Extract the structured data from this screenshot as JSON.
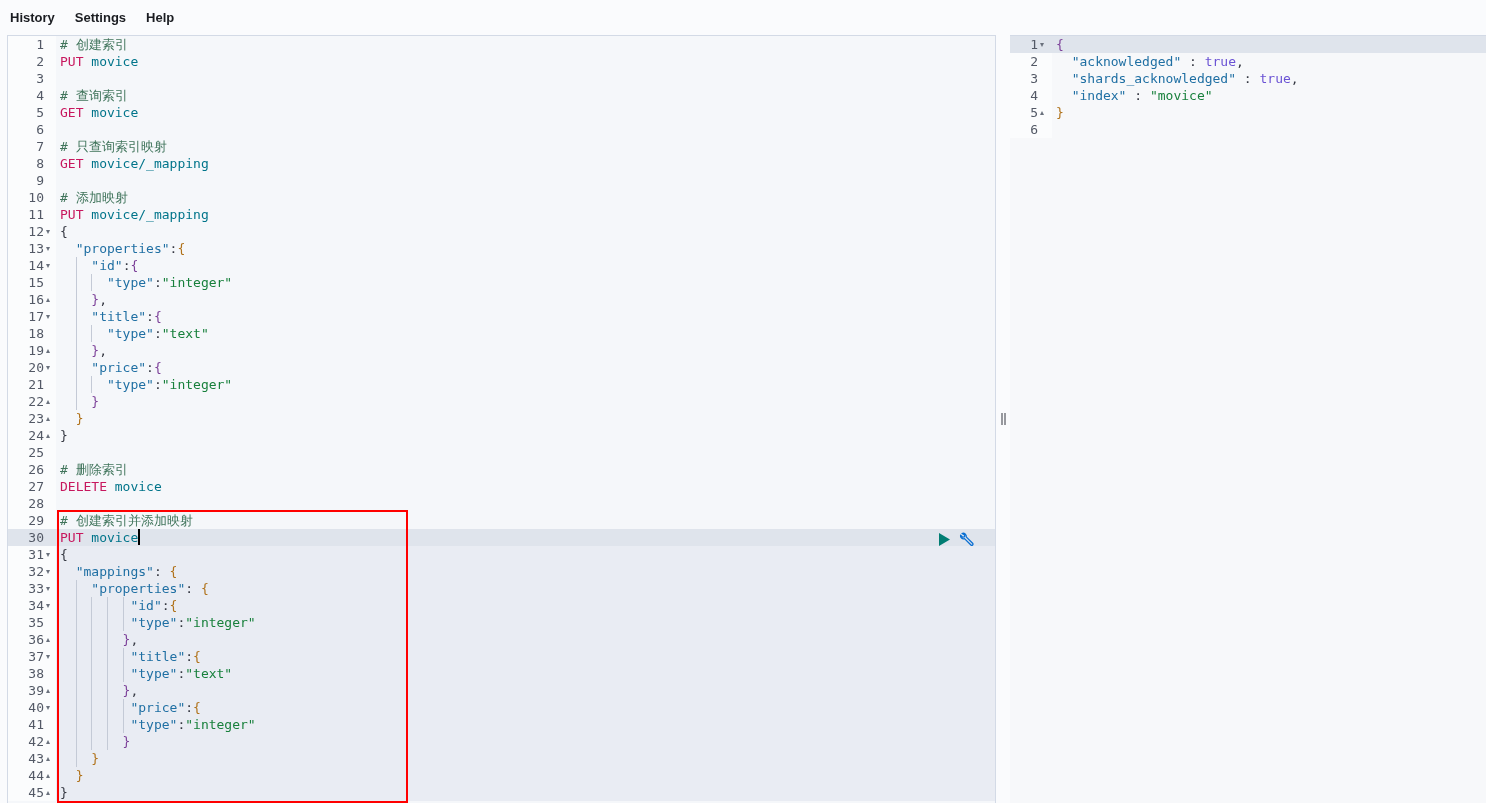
{
  "menu": [
    {
      "label": "History"
    },
    {
      "label": "Settings"
    },
    {
      "label": "Help"
    }
  ],
  "request_editor": {
    "lines": [
      {
        "no": "1",
        "tokens": [
          {
            "text": "# 创建索引",
            "kind": "comment"
          }
        ]
      },
      {
        "no": "2",
        "tokens": [
          {
            "text": "PUT",
            "kind": "method"
          },
          {
            "text": " movice",
            "kind": "path"
          }
        ]
      },
      {
        "no": "3"
      },
      {
        "no": "4",
        "tokens": [
          {
            "text": "# 查询索引",
            "kind": "comment"
          }
        ]
      },
      {
        "no": "5",
        "tokens": [
          {
            "text": "GET",
            "kind": "method"
          },
          {
            "text": " movice",
            "kind": "path"
          }
        ]
      },
      {
        "no": "6"
      },
      {
        "no": "7",
        "tokens": [
          {
            "text": "# 只查询索引映射",
            "kind": "comment"
          }
        ]
      },
      {
        "no": "8",
        "tokens": [
          {
            "text": "GET",
            "kind": "method"
          },
          {
            "text": " movice/_mapping",
            "kind": "path"
          }
        ]
      },
      {
        "no": "9"
      },
      {
        "no": "10",
        "tokens": [
          {
            "text": "# 添加映射",
            "kind": "comment"
          }
        ]
      },
      {
        "no": "11",
        "tokens": [
          {
            "text": "PUT",
            "kind": "method"
          },
          {
            "text": " movice/_mapping",
            "kind": "path"
          }
        ]
      },
      {
        "no": "12",
        "fold": "▾",
        "tokens": [
          {
            "text": "{",
            "kind": "brace1"
          }
        ]
      },
      {
        "no": "13",
        "fold": "▾",
        "tokens": [
          {
            "text": "  \"properties\"",
            "kind": "key"
          },
          {
            "text": ":",
            "kind": "punct"
          },
          {
            "text": "{",
            "kind": "brace2"
          }
        ]
      },
      {
        "no": "14",
        "fold": "▾",
        "tokens": [
          {
            "text": "    \"id\"",
            "kind": "key"
          },
          {
            "text": ":",
            "kind": "punct"
          },
          {
            "text": "{",
            "kind": "brace3"
          }
        ]
      },
      {
        "no": "15",
        "tokens": [
          {
            "text": "      \"type\"",
            "kind": "key"
          },
          {
            "text": ":",
            "kind": "punct"
          },
          {
            "text": "\"integer\"",
            "kind": "string"
          }
        ]
      },
      {
        "no": "16",
        "fold": "▴",
        "tokens": [
          {
            "text": "    }",
            "kind": "brace3"
          },
          {
            "text": ",",
            "kind": "punct"
          }
        ]
      },
      {
        "no": "17",
        "fold": "▾",
        "tokens": [
          {
            "text": "    \"title\"",
            "kind": "key"
          },
          {
            "text": ":",
            "kind": "punct"
          },
          {
            "text": "{",
            "kind": "brace3"
          }
        ]
      },
      {
        "no": "18",
        "tokens": [
          {
            "text": "      \"type\"",
            "kind": "key"
          },
          {
            "text": ":",
            "kind": "punct"
          },
          {
            "text": "\"text\"",
            "kind": "string"
          }
        ]
      },
      {
        "no": "19",
        "fold": "▴",
        "tokens": [
          {
            "text": "    }",
            "kind": "brace3"
          },
          {
            "text": ",",
            "kind": "punct"
          }
        ]
      },
      {
        "no": "20",
        "fold": "▾",
        "tokens": [
          {
            "text": "    \"price\"",
            "kind": "key"
          },
          {
            "text": ":",
            "kind": "punct"
          },
          {
            "text": "{",
            "kind": "brace3"
          }
        ]
      },
      {
        "no": "21",
        "tokens": [
          {
            "text": "      \"type\"",
            "kind": "key"
          },
          {
            "text": ":",
            "kind": "punct"
          },
          {
            "text": "\"integer\"",
            "kind": "string"
          }
        ]
      },
      {
        "no": "22",
        "fold": "▴",
        "tokens": [
          {
            "text": "    }",
            "kind": "brace3"
          }
        ]
      },
      {
        "no": "23",
        "fold": "▴",
        "tokens": [
          {
            "text": "  }",
            "kind": "brace2"
          }
        ]
      },
      {
        "no": "24",
        "fold": "▴",
        "tokens": [
          {
            "text": "}",
            "kind": "brace1"
          }
        ]
      },
      {
        "no": "25"
      },
      {
        "no": "26",
        "tokens": [
          {
            "text": "# 删除索引",
            "kind": "comment"
          }
        ]
      },
      {
        "no": "27",
        "tokens": [
          {
            "text": "DELETE",
            "kind": "method"
          },
          {
            "text": " movice",
            "kind": "path"
          }
        ]
      },
      {
        "no": "28"
      },
      {
        "no": "29",
        "tokens": [
          {
            "text": "# 创建索引并添加映射",
            "kind": "comment"
          }
        ]
      },
      {
        "no": "30",
        "active": true,
        "cursor": true,
        "actions": true,
        "tokens": [
          {
            "text": "PUT",
            "kind": "method"
          },
          {
            "text": " movice",
            "kind": "path"
          }
        ]
      },
      {
        "no": "31",
        "fold": "▾",
        "highlighted": true,
        "tokens": [
          {
            "text": "{",
            "kind": "brace1"
          }
        ]
      },
      {
        "no": "32",
        "fold": "▾",
        "highlighted": true,
        "tokens": [
          {
            "text": "  \"mappings\"",
            "kind": "key"
          },
          {
            "text": ": ",
            "kind": "punct"
          },
          {
            "text": "{",
            "kind": "brace2"
          }
        ]
      },
      {
        "no": "33",
        "fold": "▾",
        "highlighted": true,
        "tokens": [
          {
            "text": "    \"properties\"",
            "kind": "key"
          },
          {
            "text": ": ",
            "kind": "punct"
          },
          {
            "text": "{",
            "kind": "brace2"
          }
        ]
      },
      {
        "no": "34",
        "fold": "▾",
        "highlighted": true,
        "tokens": [
          {
            "text": "         \"id\"",
            "kind": "key"
          },
          {
            "text": ":",
            "kind": "punct"
          },
          {
            "text": "{",
            "kind": "brace2"
          }
        ]
      },
      {
        "no": "35",
        "highlighted": true,
        "tokens": [
          {
            "text": "         \"type\"",
            "kind": "key"
          },
          {
            "text": ":",
            "kind": "punct"
          },
          {
            "text": "\"integer\"",
            "kind": "string"
          }
        ]
      },
      {
        "no": "36",
        "fold": "▴",
        "highlighted": true,
        "tokens": [
          {
            "text": "        }",
            "kind": "brace3"
          },
          {
            "text": ",",
            "kind": "punct"
          }
        ]
      },
      {
        "no": "37",
        "fold": "▾",
        "highlighted": true,
        "tokens": [
          {
            "text": "         \"title\"",
            "kind": "key"
          },
          {
            "text": ":",
            "kind": "punct"
          },
          {
            "text": "{",
            "kind": "brace2"
          }
        ]
      },
      {
        "no": "38",
        "highlighted": true,
        "tokens": [
          {
            "text": "         \"type\"",
            "kind": "key"
          },
          {
            "text": ":",
            "kind": "punct"
          },
          {
            "text": "\"text\"",
            "kind": "string"
          }
        ]
      },
      {
        "no": "39",
        "fold": "▴",
        "highlighted": true,
        "tokens": [
          {
            "text": "        }",
            "kind": "brace3"
          },
          {
            "text": ",",
            "kind": "punct"
          }
        ]
      },
      {
        "no": "40",
        "fold": "▾",
        "highlighted": true,
        "tokens": [
          {
            "text": "         \"price\"",
            "kind": "key"
          },
          {
            "text": ":",
            "kind": "punct"
          },
          {
            "text": "{",
            "kind": "brace2"
          }
        ]
      },
      {
        "no": "41",
        "highlighted": true,
        "tokens": [
          {
            "text": "         \"type\"",
            "kind": "key"
          },
          {
            "text": ":",
            "kind": "punct"
          },
          {
            "text": "\"integer\"",
            "kind": "string"
          }
        ]
      },
      {
        "no": "42",
        "fold": "▴",
        "highlighted": true,
        "tokens": [
          {
            "text": "        }",
            "kind": "brace3"
          }
        ]
      },
      {
        "no": "43",
        "fold": "▴",
        "highlighted": true,
        "tokens": [
          {
            "text": "    }",
            "kind": "brace2"
          }
        ]
      },
      {
        "no": "44",
        "fold": "▴",
        "highlighted": true,
        "tokens": [
          {
            "text": "  }",
            "kind": "brace2"
          }
        ]
      },
      {
        "no": "45",
        "fold": "▴",
        "highlighted": true,
        "tokens": [
          {
            "text": "}",
            "kind": "brace1"
          }
        ]
      }
    ]
  },
  "response_panel": {
    "lines": [
      {
        "no": "1",
        "fold": "▾",
        "active": true,
        "tokens": [
          {
            "text": "{",
            "kind": "brace3"
          }
        ]
      },
      {
        "no": "2",
        "tokens": [
          {
            "text": "  \"acknowledged\"",
            "kind": "key"
          },
          {
            "text": " : ",
            "kind": "punct"
          },
          {
            "text": "true",
            "kind": "bool"
          },
          {
            "text": ",",
            "kind": "punct"
          }
        ]
      },
      {
        "no": "3",
        "tokens": [
          {
            "text": "  \"shards_acknowledged\"",
            "kind": "key"
          },
          {
            "text": " : ",
            "kind": "punct"
          },
          {
            "text": "true",
            "kind": "bool"
          },
          {
            "text": ",",
            "kind": "punct"
          }
        ]
      },
      {
        "no": "4",
        "tokens": [
          {
            "text": "  \"index\"",
            "kind": "key"
          },
          {
            "text": " : ",
            "kind": "punct"
          },
          {
            "text": "\"movice\"",
            "kind": "string"
          }
        ]
      },
      {
        "no": "5",
        "fold": "▴",
        "tokens": [
          {
            "text": "}",
            "kind": "brace2"
          }
        ]
      },
      {
        "no": "6"
      }
    ]
  },
  "annotation": {
    "kind": "red_box"
  }
}
